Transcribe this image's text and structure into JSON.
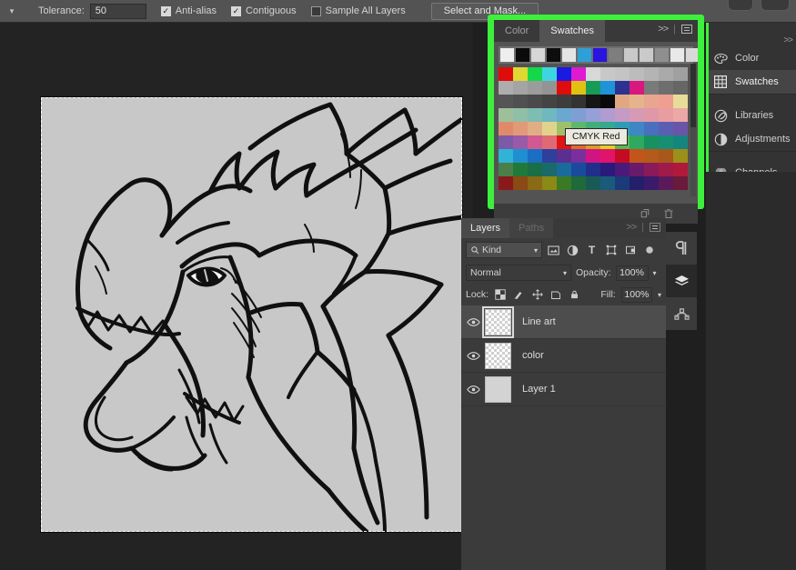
{
  "options_bar": {
    "caret_icon": "chevron-down-icon",
    "tolerance_label": "Tolerance:",
    "tolerance_value": "50",
    "antialias_label": "Anti-alias",
    "antialias_checked": true,
    "contiguous_label": "Contiguous",
    "contiguous_checked": true,
    "sample_all_layers_label": "Sample All Layers",
    "sample_all_layers_checked": false,
    "select_and_mask_label": "Select and Mask..."
  },
  "swatches_panel": {
    "highlighted": true,
    "highlight_color": "#3cf03c",
    "tabs": [
      {
        "label": "Color",
        "active": false
      },
      {
        "label": "Swatches",
        "active": true
      }
    ],
    "collapse_icon": ">>",
    "menu_icon": "hamburger-menu-icon",
    "tooltip": "CMYK Red",
    "footer_icons": [
      "new-swatch-icon",
      "delete-swatch-icon"
    ],
    "top_row": [
      "#eeeeee",
      "#0b0b0b",
      "#d6d6d6",
      "#0d0d0d",
      "#e4e4e4",
      "#2f9fd8",
      "#2a14e0",
      "#7e7e7e",
      "#c9c9c9",
      "#cacaca",
      "#8f8f8f",
      "#e9e9e9",
      "#d9d9d9"
    ],
    "grid": [
      [
        "#e00b0b",
        "#e0d832",
        "#14d84a",
        "#3fd5e0",
        "#1a1ae0",
        "#e01ad0",
        "#d8d8d8",
        "#c8c8c8",
        "#c4c4c4",
        "#bcbcbc",
        "#b4b4b4",
        "#aaaaaa",
        "#a0a0a0"
      ],
      [
        "#adadad",
        "#a4a4a4",
        "#9c9c9c",
        "#949494",
        "#e00b0b",
        "#e0c213",
        "#179b57",
        "#1f93d8",
        "#2b3290",
        "#d8177f",
        "#7a7a7a",
        "#6e6e6e",
        "#666666"
      ],
      [
        "#555555",
        "#505050",
        "#4a4a4a",
        "#444444",
        "#3d3d3d",
        "#333333",
        "#161616",
        "#0a0a0a",
        "#e0a882",
        "#e5b48a",
        "#e8a590",
        "#ee9f8f",
        "#e8dc9a"
      ],
      [
        "#9fbf9a",
        "#8fbfa6",
        "#7fbcb2",
        "#6fb8c0",
        "#6aa8d0",
        "#7f9fd4",
        "#97a0d6",
        "#b09cd0",
        "#c59ac4",
        "#d79ab4",
        "#e098a8",
        "#e89ea0",
        "#eba8a6"
      ],
      [
        "#e08a6a",
        "#e09a78",
        "#e0ae84",
        "#e0d48c",
        "#9fc06a",
        "#5fb86a",
        "#3fae78",
        "#35a890",
        "#2f9cb4",
        "#3f86c4",
        "#4a6fbf",
        "#5a5fb4",
        "#6a55a8"
      ],
      [
        "#7b5aa8",
        "#9a5aa8",
        "#d05a90",
        "#e06a74",
        "#e01414",
        "#e06a24",
        "#e09a24",
        "#e0d024",
        "#5ab850",
        "#2fa860",
        "#189060",
        "#178f74",
        "#14867f"
      ],
      [
        "#2fb4d8",
        "#1f8fd0",
        "#1a6ec4",
        "#2f3f9c",
        "#5a2f90",
        "#7a2f9c",
        "#d01484",
        "#e0146a",
        "#c40b24",
        "#c4551a",
        "#b45a1a",
        "#a8581a",
        "#9c8f1a"
      ],
      [
        "#4a7f4a",
        "#1f7a3a",
        "#1a6e46",
        "#1a6a6a",
        "#1a6a9c",
        "#1a4a9c",
        "#1f2f8a",
        "#2a1a7a",
        "#4a1a7a",
        "#6a1a6a",
        "#8a1a5a",
        "#a01a4a",
        "#b01a3a"
      ],
      [
        "#8a1a1a",
        "#8a4a14",
        "#8a6a14",
        "#8a8a14",
        "#3a7a24",
        "#1f6a3a",
        "#1a5a55",
        "#1a5a7a",
        "#1a3a7a",
        "#241f6a",
        "#3a1a6a",
        "#5a1a5a",
        "#6a1a3a"
      ]
    ]
  },
  "layers_panel": {
    "tabs": [
      {
        "label": "Layers",
        "active": true
      },
      {
        "label": "Paths",
        "active": false
      }
    ],
    "collapse_icon": ">>",
    "menu_icon": "hamburger-menu-icon",
    "filter": {
      "search_icon": "search-icon",
      "kind_label": "Kind",
      "dropdown_icon": "chevron-down-icon",
      "type_filters": [
        "pixel-layer-icon",
        "adjustment-layer-icon",
        "type-layer-icon",
        "shape-layer-icon",
        "smart-object-icon"
      ],
      "toggle_icon": "filter-toggle-icon"
    },
    "blend_mode": "Normal",
    "opacity_label": "Opacity:",
    "opacity_value": "100%",
    "lock_label": "Lock:",
    "lock_icons": [
      "lock-transparent-pixels-icon",
      "lock-image-pixels-icon",
      "lock-position-icon",
      "lock-artboard-icon",
      "lock-all-icon"
    ],
    "fill_label": "Fill:",
    "fill_value": "100%",
    "layers": [
      {
        "name": "Line art",
        "visible": true,
        "selected": true,
        "thumb": "transparent"
      },
      {
        "name": "color",
        "visible": true,
        "selected": false,
        "thumb": "transparent"
      },
      {
        "name": "Layer 1",
        "visible": true,
        "selected": false,
        "thumb": "solid"
      }
    ],
    "eye_icon": "eye-icon"
  },
  "icon_rail": {
    "buttons": [
      {
        "name": "paragraph-icon",
        "glyph": "¶",
        "active": false
      },
      {
        "name": "layers-stack-icon",
        "glyph": "≣",
        "active": true
      },
      {
        "name": "paths-node-icon",
        "glyph": "⌒",
        "active": false
      }
    ]
  },
  "right_dock": {
    "groups": [
      {
        "items": [
          {
            "label": "Color",
            "icon": "color-palette-icon",
            "active": false
          },
          {
            "label": "Swatches",
            "icon": "swatches-grid-icon",
            "active": true
          }
        ]
      },
      {
        "items": [
          {
            "label": "Libraries",
            "icon": "libraries-icon",
            "active": false
          },
          {
            "label": "Adjustments",
            "icon": "adjustments-icon",
            "active": false
          }
        ]
      },
      {
        "items": [
          {
            "label": "Channels",
            "icon": "channels-icon",
            "active": false
          }
        ]
      }
    ],
    "collapse_icon": ">>"
  },
  "canvas": {
    "artwork_name": "dragon-line-art",
    "background_color": "#c8c8c8",
    "selection_active": true
  }
}
